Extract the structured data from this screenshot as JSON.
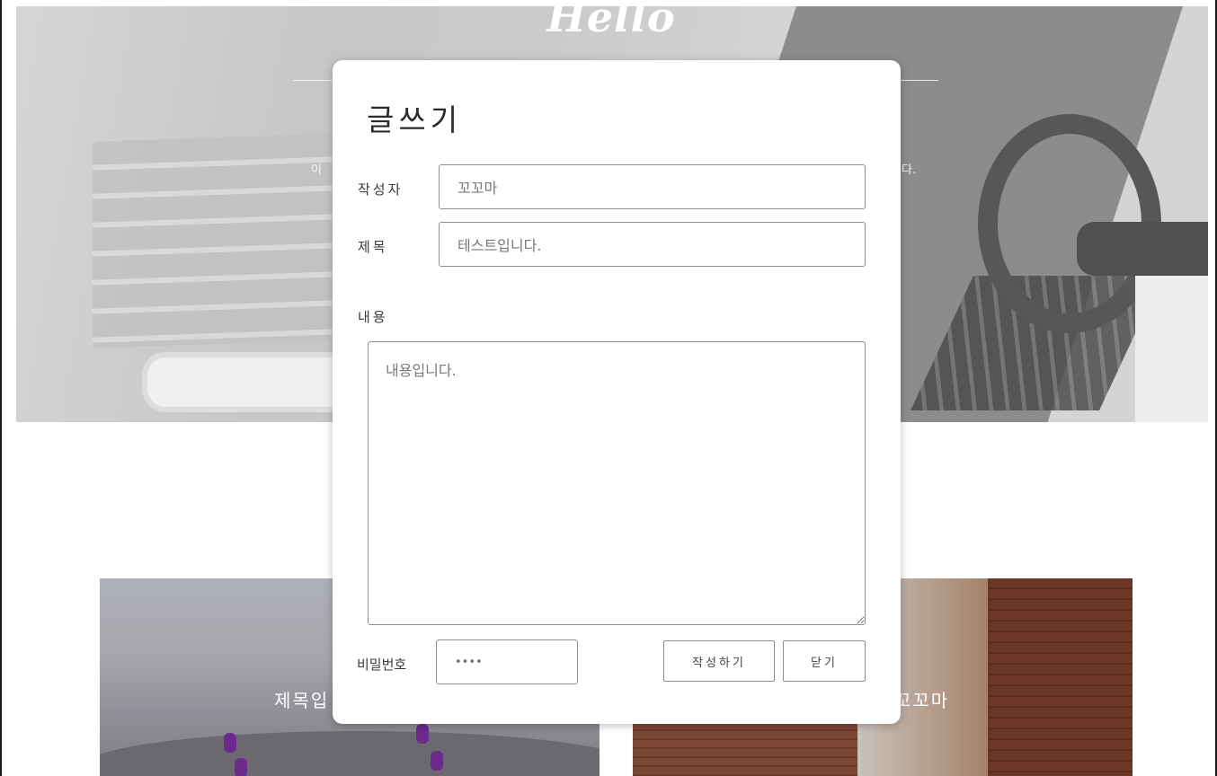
{
  "hero": {
    "title": "Hello",
    "subtitle_left": "이",
    "subtitle_right": "다."
  },
  "cards": {
    "left_title": "제목입",
    "right_title": "꼬꼬마"
  },
  "modal": {
    "title": "글쓰기",
    "author_label": "작성자",
    "author_value": "꼬꼬마",
    "subject_label": "제목",
    "subject_value": "테스트입니다.",
    "content_label": "내용",
    "content_value": "내용입니다.",
    "password_label": "비밀번호",
    "password_value": "••••",
    "submit_label": "작성하기",
    "close_label": "닫기"
  }
}
